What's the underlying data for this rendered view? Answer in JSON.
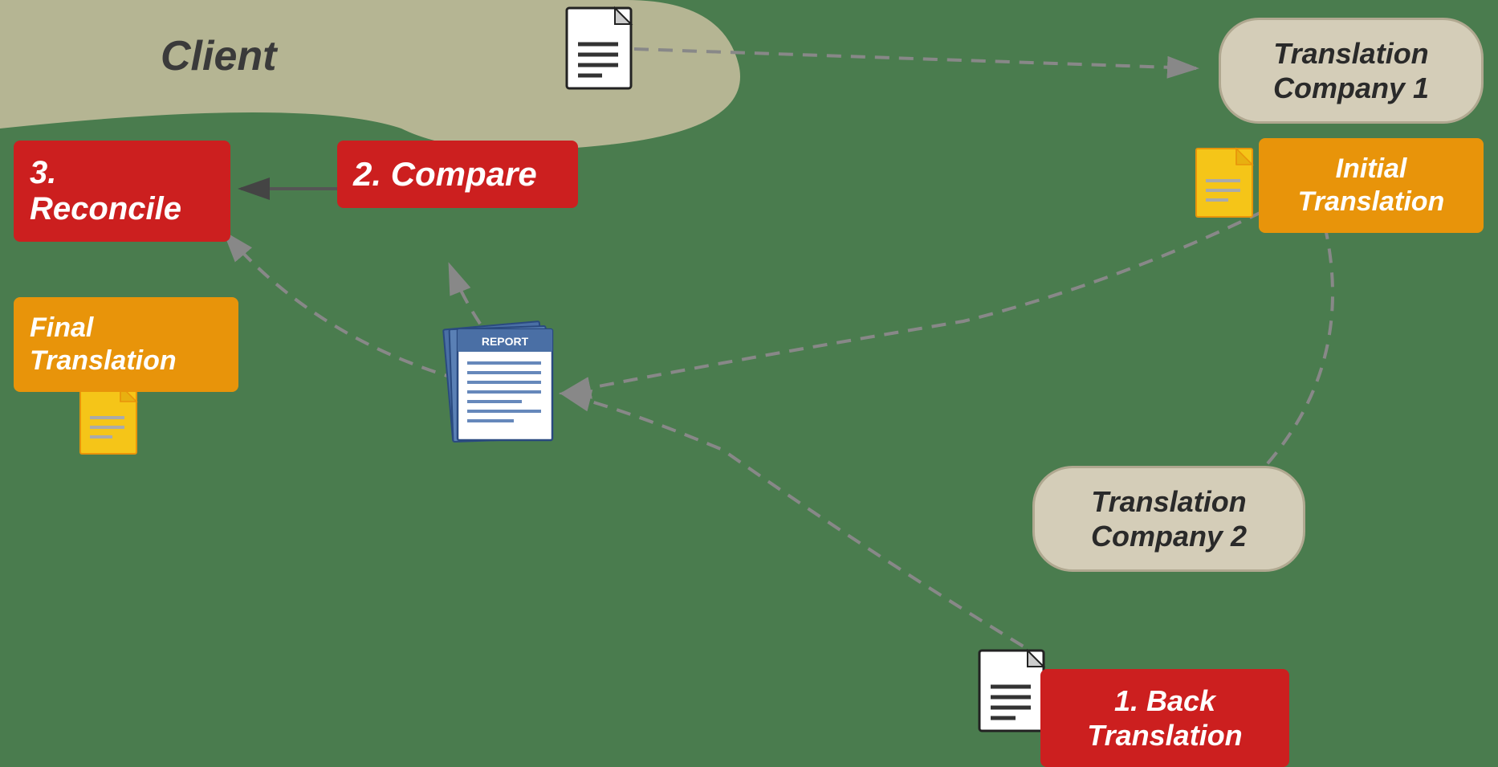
{
  "background_color": "#4a7c4e",
  "client_label": "Client",
  "tc1": {
    "label": "Translation\nCompany 1"
  },
  "initial_translation": {
    "label": "Initial\nTranslation"
  },
  "reconcile": {
    "label": "3. Reconcile"
  },
  "final_translation": {
    "label": "Final\nTranslation"
  },
  "compare": {
    "label": "2. Compare"
  },
  "tc2": {
    "label": "Translation\nCompany 2"
  },
  "back_translation": {
    "label": "1. Back\nTranslation"
  }
}
